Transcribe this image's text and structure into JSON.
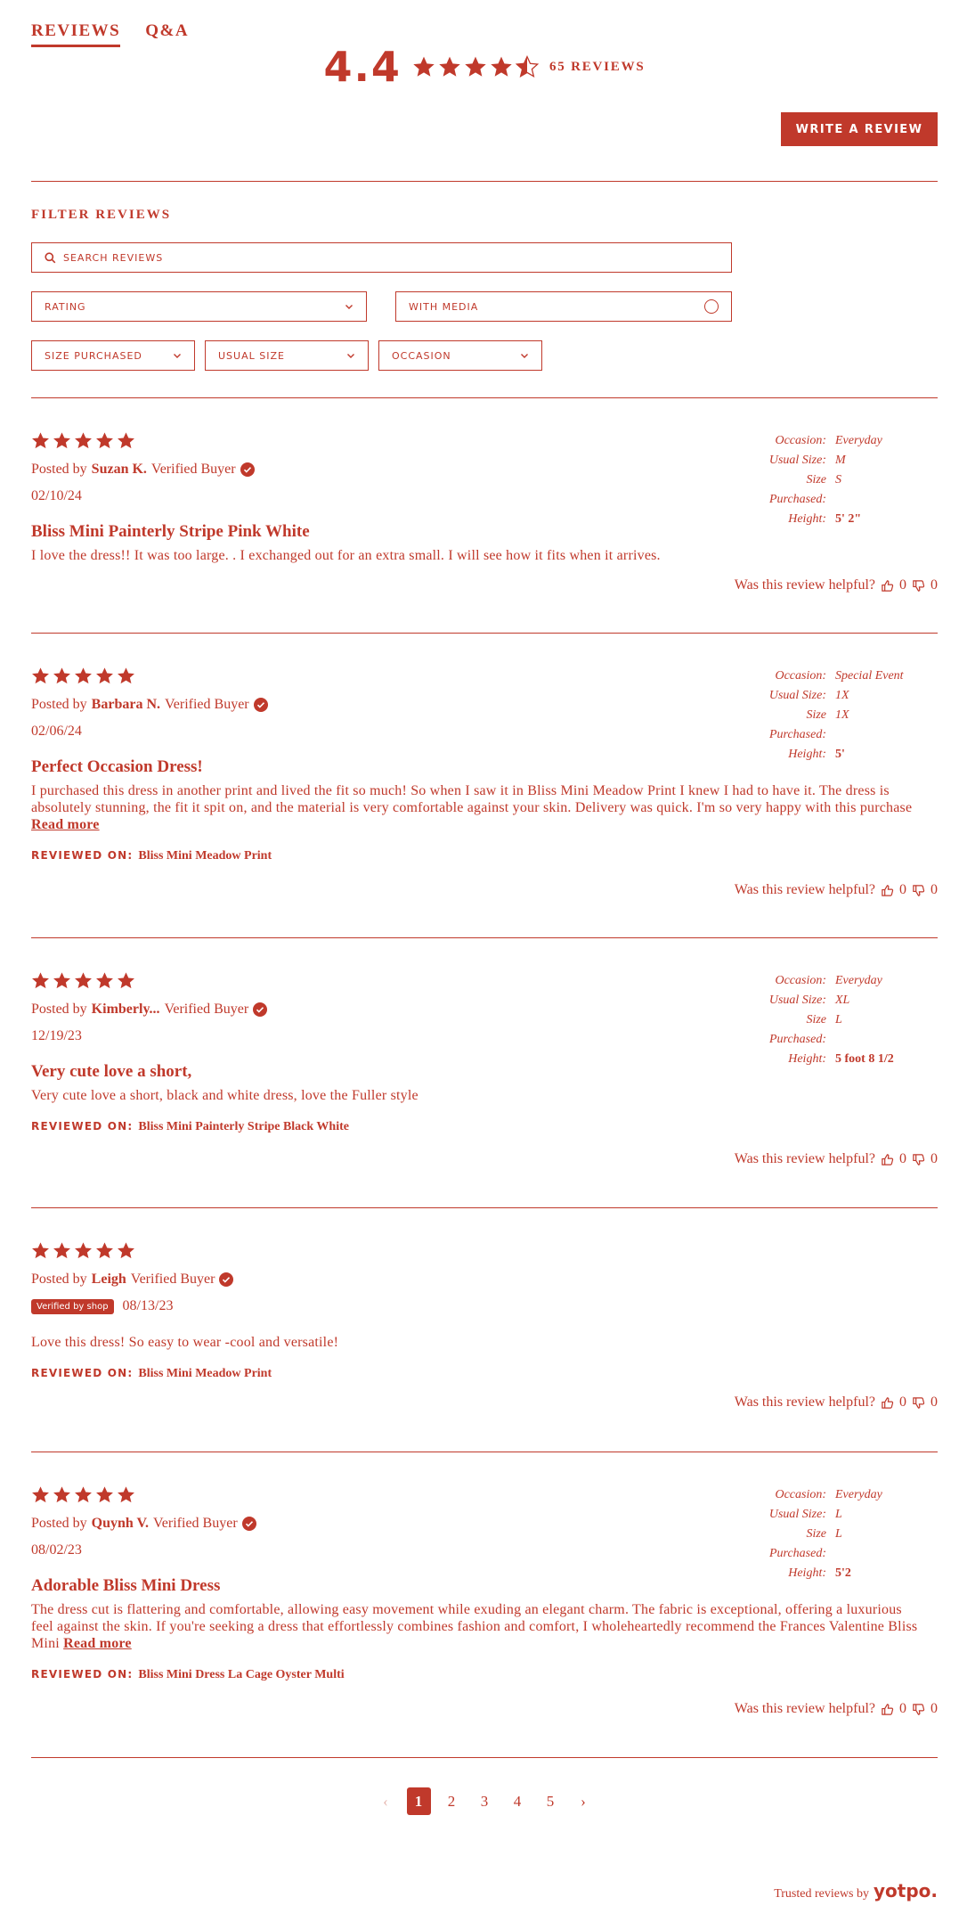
{
  "tabs": {
    "reviews": "REVIEWS",
    "qa": "Q&A"
  },
  "summary": {
    "rating": "4.4",
    "count_label": "65 REVIEWS",
    "stars": 4.5
  },
  "write_button": "WRITE A REVIEW",
  "filters": {
    "title": "FILTER REVIEWS",
    "search_placeholder": "SEARCH REVIEWS",
    "rating": "RATING",
    "with_media": "WITH MEDIA",
    "size_purchased": "SIZE PURCHASED",
    "usual_size": "USUAL SIZE",
    "occasion": "OCCASION"
  },
  "labels": {
    "posted_by": "Posted by",
    "verified_buyer": "Verified Buyer",
    "reviewed_on": "REVIEWED ON:",
    "helpful": "Was this review helpful?",
    "read_more": "Read more",
    "occasion": "Occasion:",
    "usual_size": "Usual Size:",
    "size_purchased": "Size Purchased:",
    "height": "Height:",
    "shop_badge": "Verified by shop"
  },
  "reviews": [
    {
      "stars": 5,
      "author": "Suzan K.",
      "date": "02/10/24",
      "title": "Bliss Mini Painterly Stripe Pink White",
      "body": "I love the dress!! It was too large. . I exchanged out for an extra small. I will see how it fits when it arrives.",
      "read_more": false,
      "reviewed_on": "",
      "meta": {
        "occasion": "Everyday",
        "usual_size": "M",
        "size_purchased": "S",
        "height": "5' 2\""
      },
      "up": "0",
      "down": "0"
    },
    {
      "stars": 5,
      "author": "Barbara N.",
      "date": "02/06/24",
      "title": "Perfect Occasion Dress!",
      "body": "I purchased this dress in another print and lived the fit so much! So when I saw it in Bliss Mini Meadow Print I knew I had to have it. The dress is absolutely stunning, the fit it spit on, and the material is very comfortable against your skin. Delivery was quick. I'm so very happy with this purchase",
      "read_more": true,
      "reviewed_on": "Bliss Mini Meadow Print",
      "meta": {
        "occasion": "Special Event",
        "usual_size": "1X",
        "size_purchased": "1X",
        "height": "5'"
      },
      "up": "0",
      "down": "0"
    },
    {
      "stars": 5,
      "author": "Kimberly...",
      "date": "12/19/23",
      "title": "Very cute love a short,",
      "body": "Very cute love a short, black and white dress, love the Fuller style",
      "read_more": false,
      "reviewed_on": "Bliss Mini Painterly Stripe Black White",
      "meta": {
        "occasion": "Everyday",
        "usual_size": "XL",
        "size_purchased": "L",
        "height": "5 foot 8 1/2"
      },
      "up": "0",
      "down": "0"
    },
    {
      "stars": 5,
      "author": "Leigh",
      "date": "08/13/23",
      "title": "",
      "body": "Love this dress! So easy to wear -cool and versatile!",
      "read_more": false,
      "reviewed_on": "Bliss Mini Meadow Print",
      "up": "0",
      "down": "0"
    },
    {
      "stars": 5,
      "author": "Quynh V.",
      "date": "08/02/23",
      "title": "Adorable Bliss Mini Dress",
      "body": "The dress cut is flattering and comfortable, allowing easy movement while exuding an elegant charm. The fabric is exceptional, offering a luxurious feel against the skin. If you're seeking a dress that effortlessly combines fashion and comfort, I wholeheartedly recommend the Frances Valentine Bliss Mini",
      "read_more": true,
      "reviewed_on": "Bliss Mini Dress La Cage Oyster Multi",
      "meta": {
        "occasion": "Everyday",
        "usual_size": "L",
        "size_purchased": "L",
        "height": "5'2"
      },
      "up": "0",
      "down": "0"
    }
  ],
  "pager": {
    "pages": [
      "1",
      "2",
      "3",
      "4",
      "5"
    ],
    "prev": "‹",
    "next": "›"
  },
  "footer": {
    "trusted": "Trusted reviews by",
    "brand": "yotpo."
  }
}
